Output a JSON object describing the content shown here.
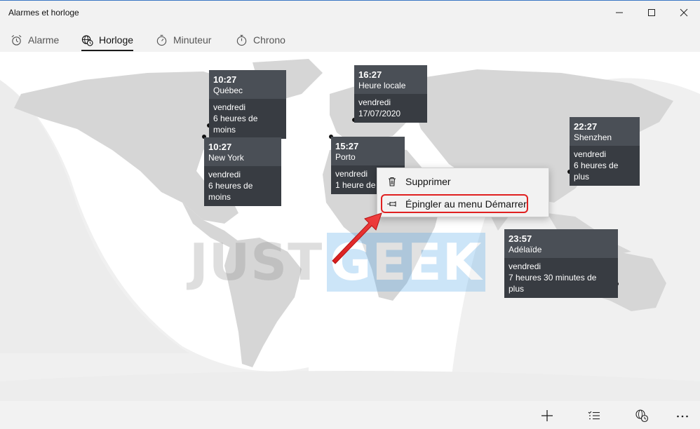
{
  "window": {
    "title": "Alarmes et horloge"
  },
  "tabs": [
    {
      "label": "Alarme",
      "icon": "alarm-clock-icon",
      "active": false
    },
    {
      "label": "Horloge",
      "icon": "world-clock-icon",
      "active": true
    },
    {
      "label": "Minuteur",
      "icon": "timer-icon",
      "active": false
    },
    {
      "label": "Chrono",
      "icon": "stopwatch-icon",
      "active": false
    }
  ],
  "watermark": {
    "part1": "JUST",
    "part2": "GEEK"
  },
  "clocks": [
    {
      "time": "10:27",
      "city": "Québec",
      "day": "vendredi",
      "offset": "6 heures de moins"
    },
    {
      "time": "16:27",
      "city": "Heure locale",
      "day": "vendredi",
      "offset": "17/07/2020"
    },
    {
      "time": "10:27",
      "city": "New York",
      "day": "vendredi",
      "offset": "6 heures de moins"
    },
    {
      "time": "15:27",
      "city": "Porto",
      "day": "vendredi",
      "offset": "1 heure de moins"
    },
    {
      "time": "22:27",
      "city": "Shenzhen",
      "day": "vendredi",
      "offset": "6 heures de plus"
    },
    {
      "time": "23:57",
      "city": "Adélaïde",
      "day": "vendredi",
      "offset": "7 heures 30 minutes de plus"
    }
  ],
  "context_menu": {
    "items": [
      {
        "label": "Supprimer",
        "icon": "trash-icon"
      },
      {
        "label": "Épingler au menu Démarrer",
        "icon": "pin-icon"
      }
    ]
  },
  "bottom_bar": {
    "icons": [
      "add-icon",
      "select-list-icon",
      "compare-clocks-icon",
      "more-icon"
    ]
  },
  "colors": {
    "card_top": "#4a4f56",
    "card_bottom": "#383c42",
    "highlight": "#e02020",
    "watermark_accent": "#4aa3e8"
  }
}
